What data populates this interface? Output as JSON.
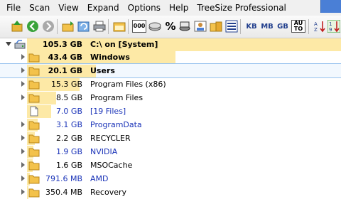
{
  "menubar": {
    "items": [
      "File",
      "Scan",
      "View",
      "Expand",
      "Options",
      "Help",
      "TreeSize Professional"
    ]
  },
  "toolbar": {
    "zeros_label": "000",
    "percent_label": "%",
    "kb_label": "KB",
    "mb_label": "MB",
    "gb_label": "GB",
    "auto_label_1": "AU",
    "auto_label_2": "TO"
  },
  "tree": {
    "root": {
      "size": "105.3 GB",
      "path": "C:\\  on  [System]"
    },
    "rows": [
      {
        "size": "43.4 GB",
        "name": "Windows",
        "fraction": 0.412
      },
      {
        "size": "20.1 GB",
        "name": "Users",
        "fraction": 0.191
      },
      {
        "size": "15.3 GB",
        "name": "Program Files (x86)",
        "fraction": 0.145
      },
      {
        "size": "8.5 GB",
        "name": "Program Files",
        "fraction": 0.081
      },
      {
        "size": "7.0 GB",
        "name": "[19 Files]",
        "fraction": 0.066
      },
      {
        "size": "3.1 GB",
        "name": "ProgramData",
        "fraction": 0.029
      },
      {
        "size": "2.2 GB",
        "name": "RECYCLER",
        "fraction": 0.021
      },
      {
        "size": "1.9 GB",
        "name": "NVIDIA",
        "fraction": 0.018
      },
      {
        "size": "1.6 GB",
        "name": "MSOCache",
        "fraction": 0.015
      },
      {
        "size": "791.6 MB",
        "name": "AMD",
        "fraction": 0.008
      },
      {
        "size": "350.4 MB",
        "name": "Recovery",
        "fraction": 0.003
      }
    ]
  },
  "colors": {
    "bar": "#fde9a6",
    "folder": "#f3c24b",
    "blue_text": "#1a33b8",
    "selection": "#98c3ee"
  }
}
